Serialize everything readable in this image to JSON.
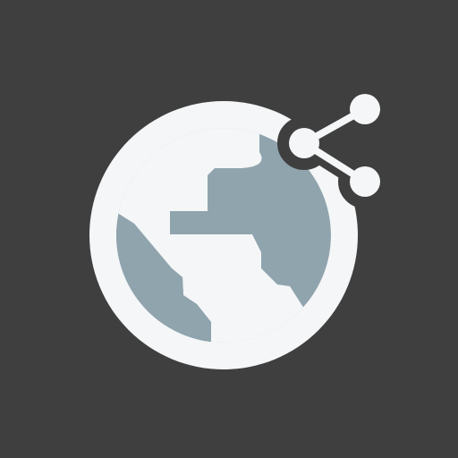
{
  "icon": {
    "name": "globe-share-icon",
    "colors": {
      "background": "#3f3f3f",
      "ring": "#f4f6f7",
      "land": "#90a4ae",
      "share_glyph": "#f4f6f7"
    }
  }
}
